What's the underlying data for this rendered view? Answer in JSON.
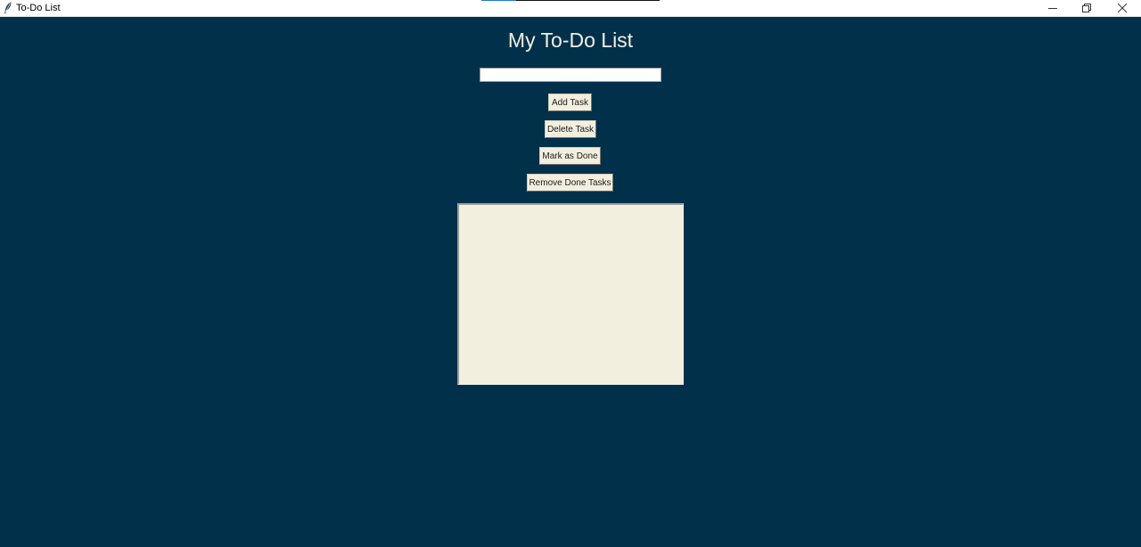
{
  "window": {
    "title": "To-Do List",
    "icon": "feather-icon",
    "controls": {
      "minimize_icon": "minimize-icon",
      "maximize_icon": "restore-icon",
      "close_icon": "close-icon"
    }
  },
  "app": {
    "heading": "My To-Do List",
    "task_input": {
      "value": "",
      "placeholder": ""
    },
    "buttons": {
      "add_task": "Add Task",
      "delete_task": "Delete Task",
      "mark_as_done": "Mark as Done",
      "remove_done_tasks": "Remove Done Tasks"
    },
    "tasks": []
  },
  "colors": {
    "background": "#00304a",
    "heading_text": "#f2efe3",
    "button_bg": "#f3efdf",
    "list_bg": "#f3efdf"
  }
}
